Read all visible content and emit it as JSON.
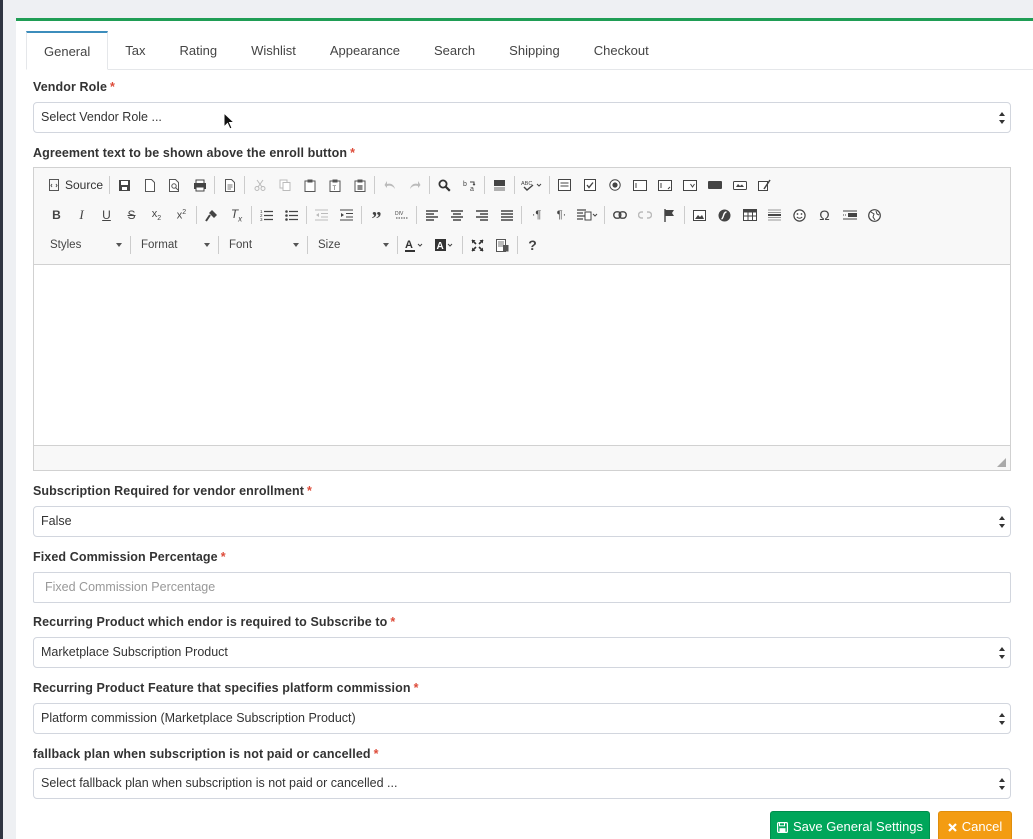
{
  "tabs": [
    "General",
    "Tax",
    "Rating",
    "Wishlist",
    "Appearance",
    "Search",
    "Shipping",
    "Checkout"
  ],
  "active_tab": "General",
  "vendor_role": {
    "label": "Vendor Role",
    "value": "Select Vendor Role ..."
  },
  "agreement": {
    "label": "Agreement text to be shown above the enroll button"
  },
  "editor": {
    "source_label": "Source",
    "combos": [
      "Styles",
      "Format",
      "Font",
      "Size"
    ]
  },
  "subscription_required": {
    "label": "Subscription Required for vendor enrollment",
    "value": "False"
  },
  "fixed_commission": {
    "label": "Fixed Commission Percentage",
    "placeholder": "Fixed Commission Percentage"
  },
  "recurring_product": {
    "label": "Recurring Product which endor is required to Subscribe to",
    "value": "Marketplace Subscription Product"
  },
  "recurring_feature": {
    "label": "Recurring Product Feature that specifies platform commission",
    "value": "Platform commission (Marketplace Subscription Product)"
  },
  "fallback_plan": {
    "label": "fallback plan when subscription is not paid or cancelled",
    "value": "Select fallback plan when subscription is not paid or cancelled ..."
  },
  "buttons": {
    "save": "Save General Settings",
    "cancel": "Cancel"
  },
  "required_marker": "*",
  "colors": {
    "accent": "#1f9d55",
    "save": "#00a65a",
    "cancel": "#f39c12",
    "required": "#dd4b39"
  }
}
